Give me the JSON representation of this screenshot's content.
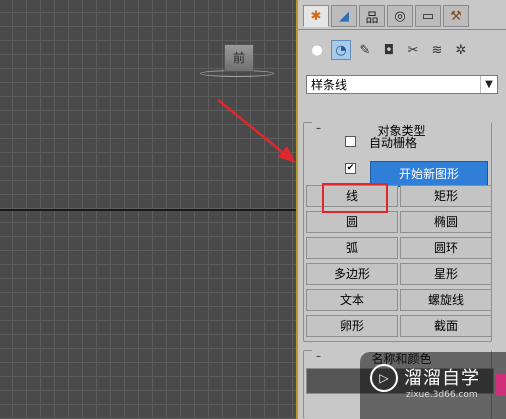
{
  "viewport": {
    "viewcube_label": "前"
  },
  "command_panel": {
    "tabs": [
      {
        "name": "create",
        "icon": "✱"
      },
      {
        "name": "modify",
        "icon": "◢"
      },
      {
        "name": "hierarchy",
        "icon": "品"
      },
      {
        "name": "motion",
        "icon": "◎"
      },
      {
        "name": "display",
        "icon": "▭"
      },
      {
        "name": "utilities",
        "icon": "⚒"
      }
    ],
    "subtabs": [
      {
        "name": "geometry",
        "icon": "●"
      },
      {
        "name": "shapes",
        "icon": "◔"
      },
      {
        "name": "lights",
        "icon": "✎"
      },
      {
        "name": "cameras",
        "icon": "◘"
      },
      {
        "name": "helpers",
        "icon": "✂"
      },
      {
        "name": "space-warps",
        "icon": "≋"
      },
      {
        "name": "systems",
        "icon": "✲"
      }
    ],
    "category": "样条线",
    "object_type": {
      "title": "对象类型",
      "auto_grid_label": "自动栅格",
      "auto_grid_checked": false,
      "start_new_shape_checked": true,
      "start_new_shape_label": "开始新图形",
      "buttons": [
        "线",
        "矩形",
        "圆",
        "椭圆",
        "弧",
        "圆环",
        "多边形",
        "星形",
        "文本",
        "螺旋线",
        "卵形",
        "截面"
      ]
    },
    "second_rollout_title": "名称和颜色"
  },
  "watermark": {
    "title": "溜溜自学",
    "url": "zixue.3d66.com",
    "logo": "▷"
  }
}
